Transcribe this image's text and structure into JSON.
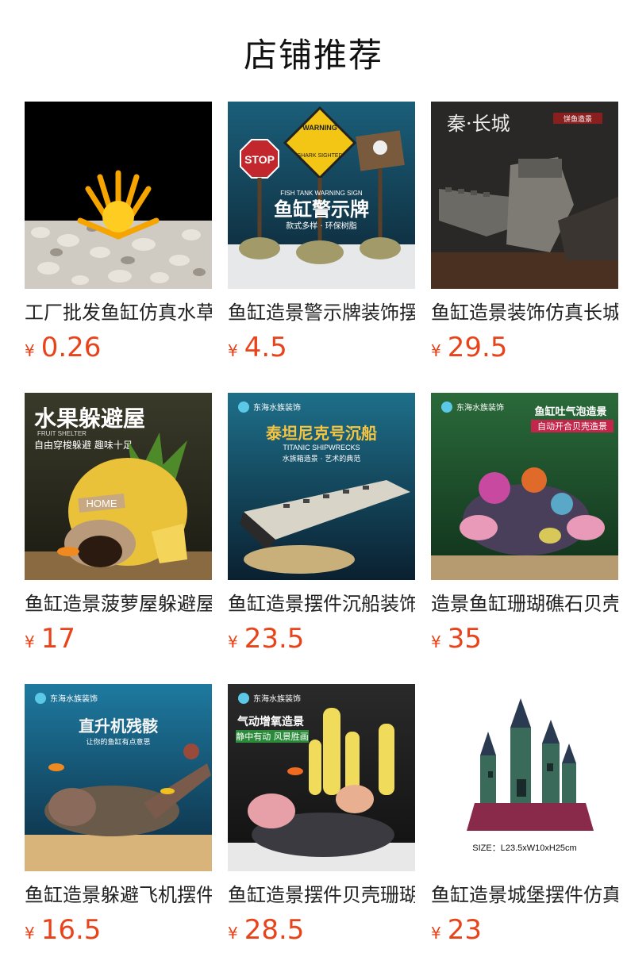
{
  "page_title": "店铺推荐",
  "currency": "¥",
  "products": [
    {
      "name": "工厂批发鱼缸仿真水草",
      "price": "0.26"
    },
    {
      "name": "鱼缸造景警示牌装饰摆件",
      "price": "4.5",
      "image_text": {
        "banner_en": "FISH TANK WARNING SIGN",
        "banner_cn": "鱼缸警示牌",
        "sub": "款式多样 · 环保树脂",
        "sign_stop": "STOP",
        "sign_warning": "WARNING",
        "sign_shark": "SHARK SIGHTED"
      }
    },
    {
      "name": "鱼缸造景装饰仿真长城",
      "price": "29.5",
      "image_text": {
        "title": "秦·长城",
        "badge": "饼鱼造景"
      }
    },
    {
      "name": "鱼缸造景菠萝屋躲避屋",
      "price": "17",
      "image_text": {
        "title": "水果躲避屋",
        "sub_en": "FRUIT SHELTER",
        "sub": "自由穿梭躲避 趣味十足",
        "door": "HOME"
      }
    },
    {
      "name": "鱼缸造景摆件沉船装饰",
      "price": "23.5",
      "image_text": {
        "brand": "东海水族装饰",
        "title": "泰坦尼克号沉船",
        "sub_en": "TITANIC SHIPWRECKS",
        "sub": "水族箱造景 · 艺术的典范"
      }
    },
    {
      "name": "造景鱼缸珊瑚礁石贝壳",
      "price": "35",
      "image_text": {
        "brand": "东海水族装饰",
        "title": "鱼缸吐气泡造景",
        "sub": "自动开合贝壳造景"
      }
    },
    {
      "name": "鱼缸造景躲避飞机摆件",
      "price": "16.5",
      "image_text": {
        "brand": "东海水族装饰",
        "title": "直升机残骸",
        "sub": "让你的鱼缸有点意思"
      }
    },
    {
      "name": "鱼缸造景摆件贝壳珊瑚",
      "price": "28.5",
      "image_text": {
        "brand": "东海水族装饰",
        "title": "气动增氧造景",
        "sub": "静中有动 风景胜画"
      }
    },
    {
      "name": "鱼缸造景城堡摆件仿真",
      "price": "23",
      "image_text": {
        "size": "SIZE：L23.5xW10xH25cm"
      }
    }
  ]
}
